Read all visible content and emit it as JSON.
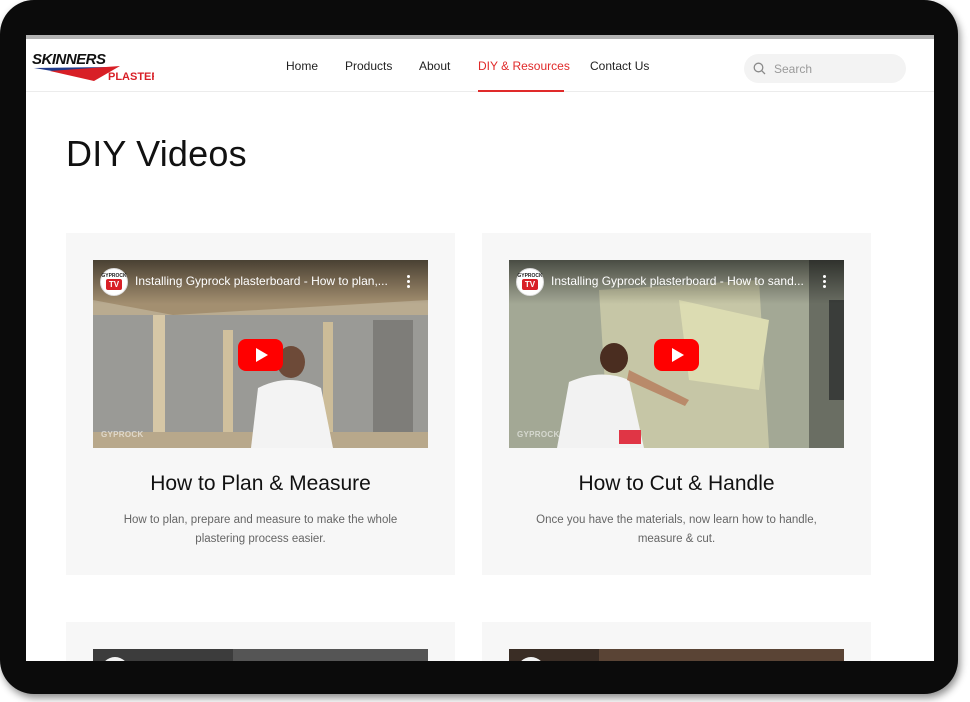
{
  "brand": {
    "logo_top": "SKINNERS",
    "logo_bottom": "PLASTER",
    "colors": {
      "accent": "#e02a2a",
      "logo_blue": "#1f3a8a",
      "logo_red": "#d81f26"
    }
  },
  "nav": {
    "items": [
      {
        "label": "Home",
        "active": false
      },
      {
        "label": "Products",
        "active": false
      },
      {
        "label": "About",
        "active": false
      },
      {
        "label": "DIY & Resources",
        "active": true
      },
      {
        "label": "Contact Us",
        "active": false
      }
    ]
  },
  "search": {
    "placeholder": "Search",
    "icon": "search-icon"
  },
  "page": {
    "title": "DIY Videos"
  },
  "cards": [
    {
      "video_title": "Installing Gyprock plasterboard - How to plan,...",
      "channel_badge_top": "GYPROCK",
      "channel_badge_bottom": "TV",
      "watermark": "GYPROCK",
      "title": "How to Plan & Measure",
      "description": "How to plan, prepare and measure to make the whole plastering process easier."
    },
    {
      "video_title": "Installing Gyprock plasterboard - How to sand...",
      "channel_badge_top": "GYPROCK",
      "channel_badge_bottom": "TV",
      "watermark": "GYPROCK",
      "title": "How to Cut & Handle",
      "description": "Once you have the materials, now learn how to handle, measure & cut."
    }
  ]
}
